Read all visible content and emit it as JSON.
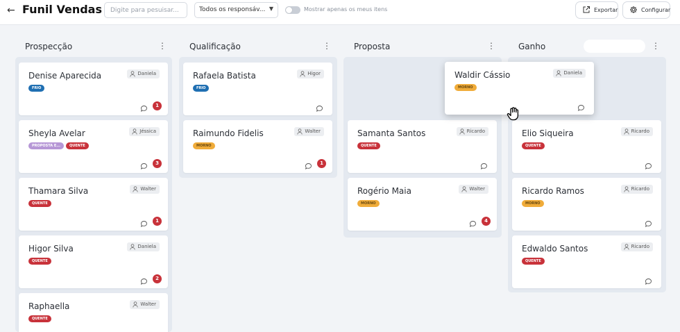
{
  "header": {
    "back_icon": "arrow-left-icon",
    "title": "Funil Vendas",
    "search_placeholder": "Digite para pesuisar...",
    "responsible_select": "Todos os responsáv...",
    "toggle_label": "Mostrar apenas os meus itens",
    "toggle_on": false,
    "export_label": "Exportar",
    "config_label": "Configurar"
  },
  "columns": [
    {
      "title": "Prospecção",
      "cards": [
        {
          "name": "Denise Aparecida",
          "owner": "Daniela",
          "tags": [
            {
              "label": "FRIO",
              "kind": "frio"
            }
          ],
          "comments": "1"
        },
        {
          "name": "Sheyla Avelar",
          "owner": "Jéssica",
          "tags": [
            {
              "label": "PROPOSTA E...",
              "kind": "proposta"
            },
            {
              "label": "QUENTE",
              "kind": "quente"
            }
          ],
          "comments": "3"
        },
        {
          "name": "Thamara Silva",
          "owner": "Walter",
          "tags": [
            {
              "label": "QUENTE",
              "kind": "quente"
            }
          ],
          "comments": "1"
        },
        {
          "name": "Higor Silva",
          "owner": "Daniela",
          "tags": [
            {
              "label": "QUENTE",
              "kind": "quente"
            }
          ],
          "comments": "2"
        },
        {
          "name": "Raphaella",
          "owner": "Walter",
          "tags": [
            {
              "label": "QUENTE",
              "kind": "quente"
            }
          ],
          "comments": ""
        }
      ]
    },
    {
      "title": "Qualificação",
      "cards": [
        {
          "name": "Rafaela Batista",
          "owner": "Higor",
          "tags": [
            {
              "label": "FRIO",
              "kind": "frio"
            }
          ],
          "comments": ""
        },
        {
          "name": "Raimundo Fidelis",
          "owner": "Walter",
          "tags": [
            {
              "label": "MORNO",
              "kind": "morno"
            }
          ],
          "comments": "1"
        }
      ]
    },
    {
      "title": "Proposta",
      "cards": [
        {
          "name": "Samanta Santos",
          "owner": "Ricardo",
          "tags": [
            {
              "label": "QUENTE",
              "kind": "quente"
            }
          ],
          "comments": ""
        },
        {
          "name": "Rogério Maia",
          "owner": "Walter",
          "tags": [
            {
              "label": "MORNO",
              "kind": "morno"
            }
          ],
          "comments": "4"
        }
      ]
    },
    {
      "title": "Ganho",
      "cards": [
        {
          "name": "Elio Siqueira",
          "owner": "Ricardo",
          "tags": [
            {
              "label": "QUENTE",
              "kind": "quente"
            }
          ],
          "comments": ""
        },
        {
          "name": "Ricardo Ramos",
          "owner": "Ricardo",
          "tags": [
            {
              "label": "MORNO",
              "kind": "morno"
            }
          ],
          "comments": ""
        },
        {
          "name": "Edwaldo Santos",
          "owner": "Ricardo",
          "tags": [
            {
              "label": "QUENTE",
              "kind": "quente"
            }
          ],
          "comments": ""
        }
      ]
    }
  ],
  "dragging_card": {
    "name": "Waldir Cássio",
    "owner": "Daniela",
    "tags": [
      {
        "label": "MORNO",
        "kind": "morno"
      }
    ],
    "comments": ""
  },
  "icons": {
    "column_menu": "vertical-dots-icon",
    "owner": "user-icon",
    "comment": "comment-icon",
    "export": "external-link-icon",
    "config": "gear-icon",
    "cursor": "grab-hand-icon"
  },
  "colors": {
    "quente": "#c8323a",
    "frio": "#1f6fb2",
    "morno": "#f0ac3a",
    "proposta": "#b697d6",
    "badge": "#c8323a"
  }
}
